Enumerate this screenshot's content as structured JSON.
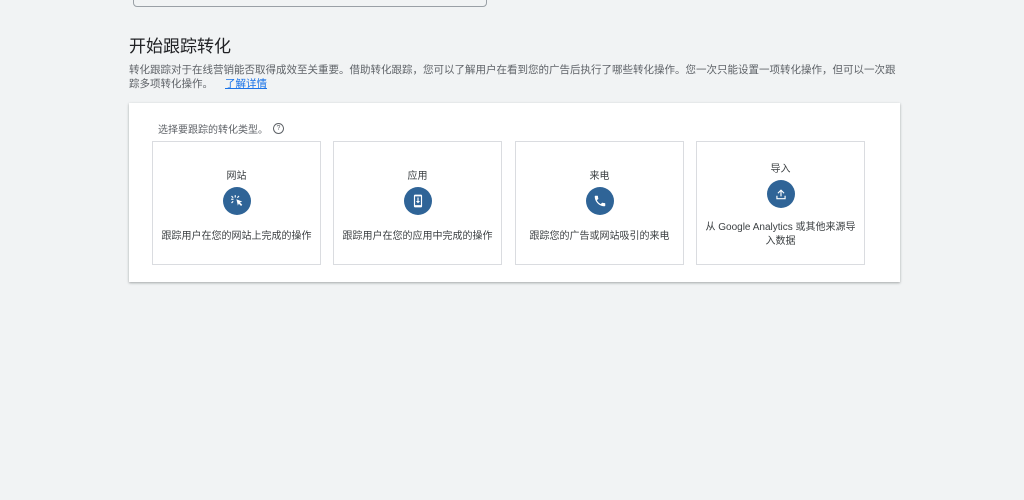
{
  "header": {
    "title": "开始跟踪转化",
    "description": "转化跟踪对于在线营销能否取得成效至关重要。借助转化跟踪，您可以了解用户在看到您的广告后执行了哪些转化操作。您一次只能设置一项转化操作，但可以一次跟踪多项转化操作。",
    "learn_more": "了解详情"
  },
  "card": {
    "label": "选择要跟踪的转化类型。",
    "help_icon": "?",
    "tiles": [
      {
        "title": "网站",
        "icon": "cursor-click-icon",
        "description": "跟踪用户在您的网站上完成的操作"
      },
      {
        "title": "应用",
        "icon": "phone-download-icon",
        "description": "跟踪用户在您的应用中完成的操作"
      },
      {
        "title": "来电",
        "icon": "phone-call-icon",
        "description": "跟踪您的广告或网站吸引的来电"
      },
      {
        "title": "导入",
        "icon": "upload-icon",
        "description": "从 Google Analytics 或其他来源导入数据"
      }
    ]
  },
  "colors": {
    "accent": "#2f6497",
    "link": "#1a73e8",
    "background": "#f1f3f4"
  }
}
